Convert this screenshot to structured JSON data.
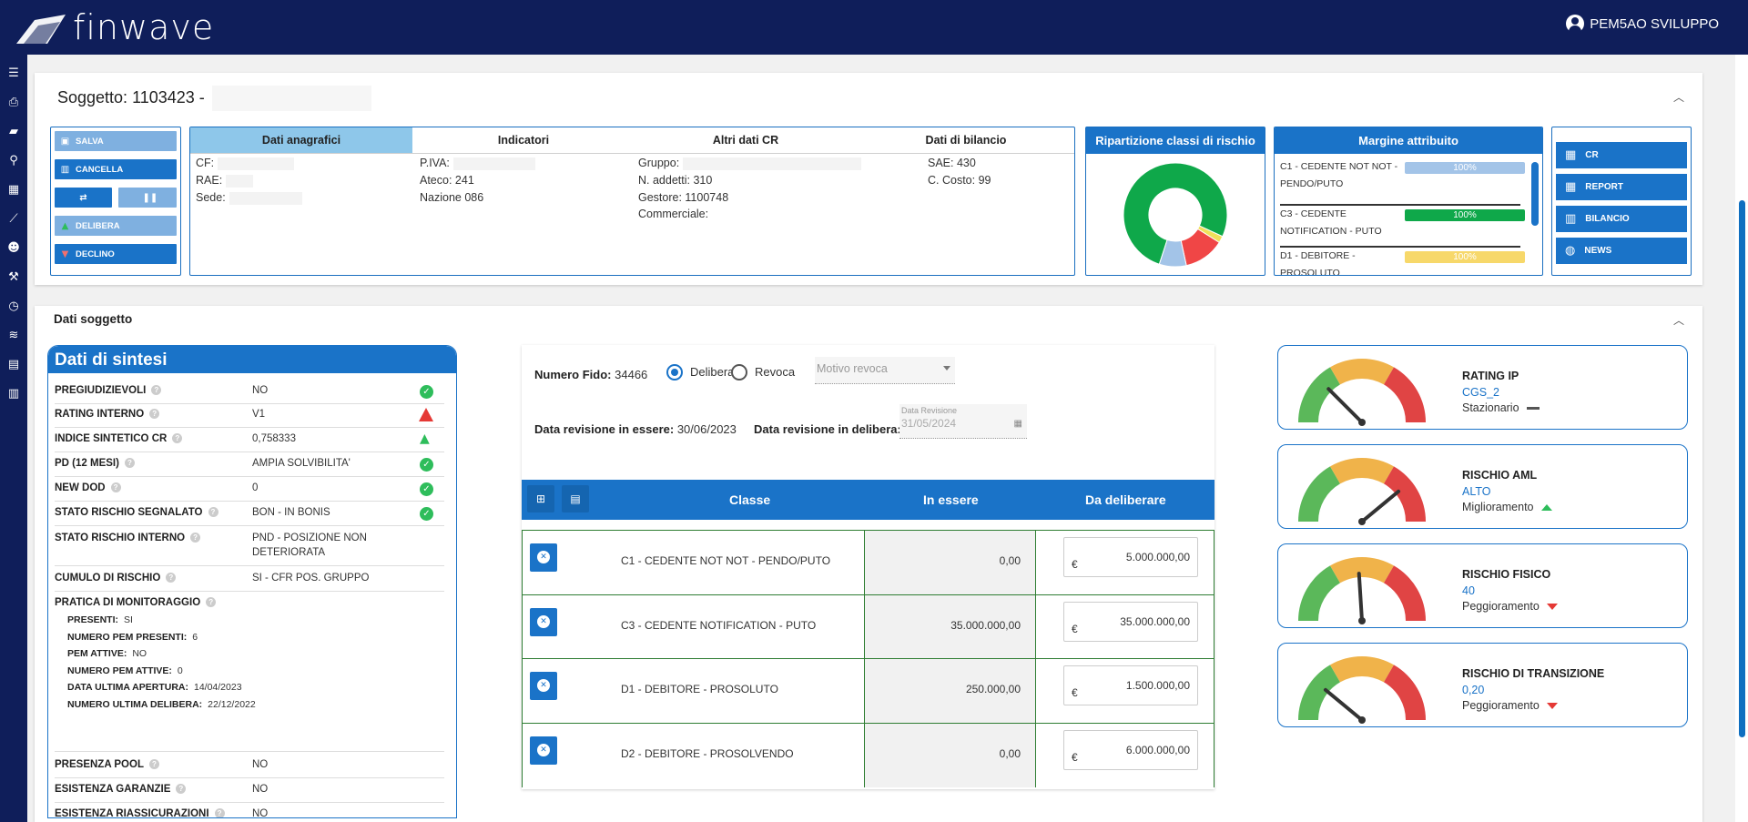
{
  "header": {
    "logo_text": "finwave",
    "user": "PEM5AO SVILUPPO"
  },
  "colors": {
    "navy": "#0f1e5a",
    "blue": "#1a73c8",
    "green": "#2ebd5b",
    "red": "#e53935",
    "amber": "#f0b34a"
  },
  "sidebar": {
    "icons": [
      "menu-icon",
      "print-icon",
      "chat-icon",
      "attachment-icon",
      "calendar-check-icon",
      "chart-line-icon",
      "users-icon",
      "hammer-icon",
      "clock-icon",
      "layers-icon",
      "document-icon",
      "table-icon"
    ]
  },
  "soggetto": {
    "title": "Soggetto: 1103423 -",
    "actions": {
      "salva": "SALVA",
      "cancella": "CANCELLA",
      "delibera": "DELIBERA",
      "declino": "DECLINO"
    },
    "tabs": [
      "Dati anagrafici",
      "Indicatori",
      "Altri dati CR",
      "Dati di bilancio"
    ],
    "anagrafica": {
      "cf": "CF:",
      "rae": "RAE:",
      "sede": "Sede:"
    },
    "indicatori": {
      "piva": "P.IVA:",
      "ateco": "Ateco: 241",
      "nazione": "Nazione 086"
    },
    "altri": {
      "gruppo": "Gruppo:",
      "addetti": "N. addetti: 310",
      "gestore": "Gestore: 1100748",
      "commerciale": "Commerciale:"
    },
    "bilancio": {
      "sae": "SAE: 430",
      "costo": "C. Costo: 99"
    },
    "ripartizione_title": "Ripartizione classi di rischio",
    "ripartizione": [
      {
        "value": 73,
        "color": "#0fa84a"
      },
      {
        "value": 2,
        "color": "#f0e05a"
      },
      {
        "value": 12,
        "color": "#f04646"
      },
      {
        "value": 8,
        "color": "#a3c4e8"
      }
    ],
    "margine_title": "Margine attribuito",
    "margine": [
      {
        "label1": "C1 - CEDENTE NOT NOT -",
        "label2": "PENDO/PUTO",
        "pct": "100%",
        "color": "#a3c4e8"
      },
      {
        "label1": "C3 - CEDENTE",
        "label2": "NOTIFICATION - PUTO",
        "pct": "100%",
        "color": "#0fa84a"
      },
      {
        "label1": "D1 - DEBITORE -",
        "label2": "PROSOLUTO",
        "pct": "100%",
        "color": "#f7d86a"
      }
    ],
    "nav": {
      "cr": "CR",
      "report": "REPORT",
      "bilancio": "BILANCIO",
      "news": "NEWS"
    }
  },
  "dati_soggetto": {
    "title": "Dati soggetto",
    "sintesi": {
      "title": "Dati di sintesi",
      "rows": [
        {
          "k": "PREGIUDIZIEVOLI",
          "v": "NO"
        },
        {
          "k": "RATING INTERNO",
          "v": "V1"
        },
        {
          "k": "INDICE SINTETICO CR",
          "v": "0,758333"
        },
        {
          "k": "PD (12 MESI)",
          "v": "AMPIA SOLVIBILITA'"
        },
        {
          "k": "NEW DOD",
          "v": "0"
        },
        {
          "k": "STATO RISCHIO SEGNALATO",
          "v": "BON - IN BONIS"
        },
        {
          "k": "STATO RISCHIO INTERNO",
          "v": "PND - POSIZIONE NON",
          "v2": "DETERIORATA"
        },
        {
          "k": "CUMULO DI RISCHIO",
          "v": "SI - CFR POS. GRUPPO"
        },
        {
          "k": "PRATICA DI MONITORAGGIO",
          "v": ""
        },
        {
          "k": "PRESENZA POOL",
          "v": "NO"
        },
        {
          "k": "ESISTENZA GARANZIE",
          "v": "NO"
        },
        {
          "k": "ESISTENZA RIASSICURAZIONI",
          "v": "NO"
        }
      ],
      "monitoraggio": [
        {
          "k": "PRESENTI:",
          "v": "SI"
        },
        {
          "k": "NUMERO PEM PRESENTI:",
          "v": "6"
        },
        {
          "k": "PEM ATTIVE:",
          "v": "NO"
        },
        {
          "k": "NUMERO PEM ATTIVE:",
          "v": "0"
        },
        {
          "k": "DATA ULTIMA APERTURA:",
          "v": "14/04/2023"
        },
        {
          "k": "NUMERO ULTIMA DELIBERA:",
          "v": "22/12/2022"
        }
      ]
    },
    "fido": {
      "numero_label": "Numero Fido:",
      "numero": "34466",
      "delibera": "Delibera",
      "revoca": "Revoca",
      "motivo_placeholder": "Motivo revoca",
      "rev_essere_label": "Data revisione in essere:",
      "rev_essere": "30/06/2023",
      "rev_delibera_label": "Data revisione in delibera:",
      "rev_field_label": "Data Revisione",
      "rev_field": "31/05/2024",
      "columns": [
        "Classe",
        "In essere",
        "Da deliberare"
      ],
      "rows": [
        {
          "classe": "C1 - CEDENTE NOT NOT - PENDO/PUTO",
          "essere": "0,00",
          "deliberare": "5.000.000,00"
        },
        {
          "classe": "C3 - CEDENTE NOTIFICATION - PUTO",
          "essere": "35.000.000,00",
          "deliberare": "35.000.000,00"
        },
        {
          "classe": "D1 - DEBITORE - PROSOLUTO",
          "essere": "250.000,00",
          "deliberare": "1.500.000,00"
        },
        {
          "classe": "D2 - DEBITORE - PROSOLVENDO",
          "essere": "0,00",
          "deliberare": "6.000.000,00"
        }
      ],
      "currency": "€"
    },
    "gauges": [
      {
        "title": "RATING IP",
        "value": "CGS_2",
        "trend": "Stazionario",
        "trend_dir": "flat",
        "needle": 0.25
      },
      {
        "title": "RISCHIO AML",
        "value": "ALTO",
        "trend": "Miglioramento",
        "trend_dir": "up",
        "needle": 0.78
      },
      {
        "title": "RISCHIO FISICO",
        "value": "40",
        "trend": "Peggioramento",
        "trend_dir": "down",
        "needle": 0.48
      },
      {
        "title": "RISCHIO DI TRANSIZIONE",
        "value": "0,20",
        "trend": "Peggioramento",
        "trend_dir": "down",
        "needle": 0.22
      }
    ]
  }
}
